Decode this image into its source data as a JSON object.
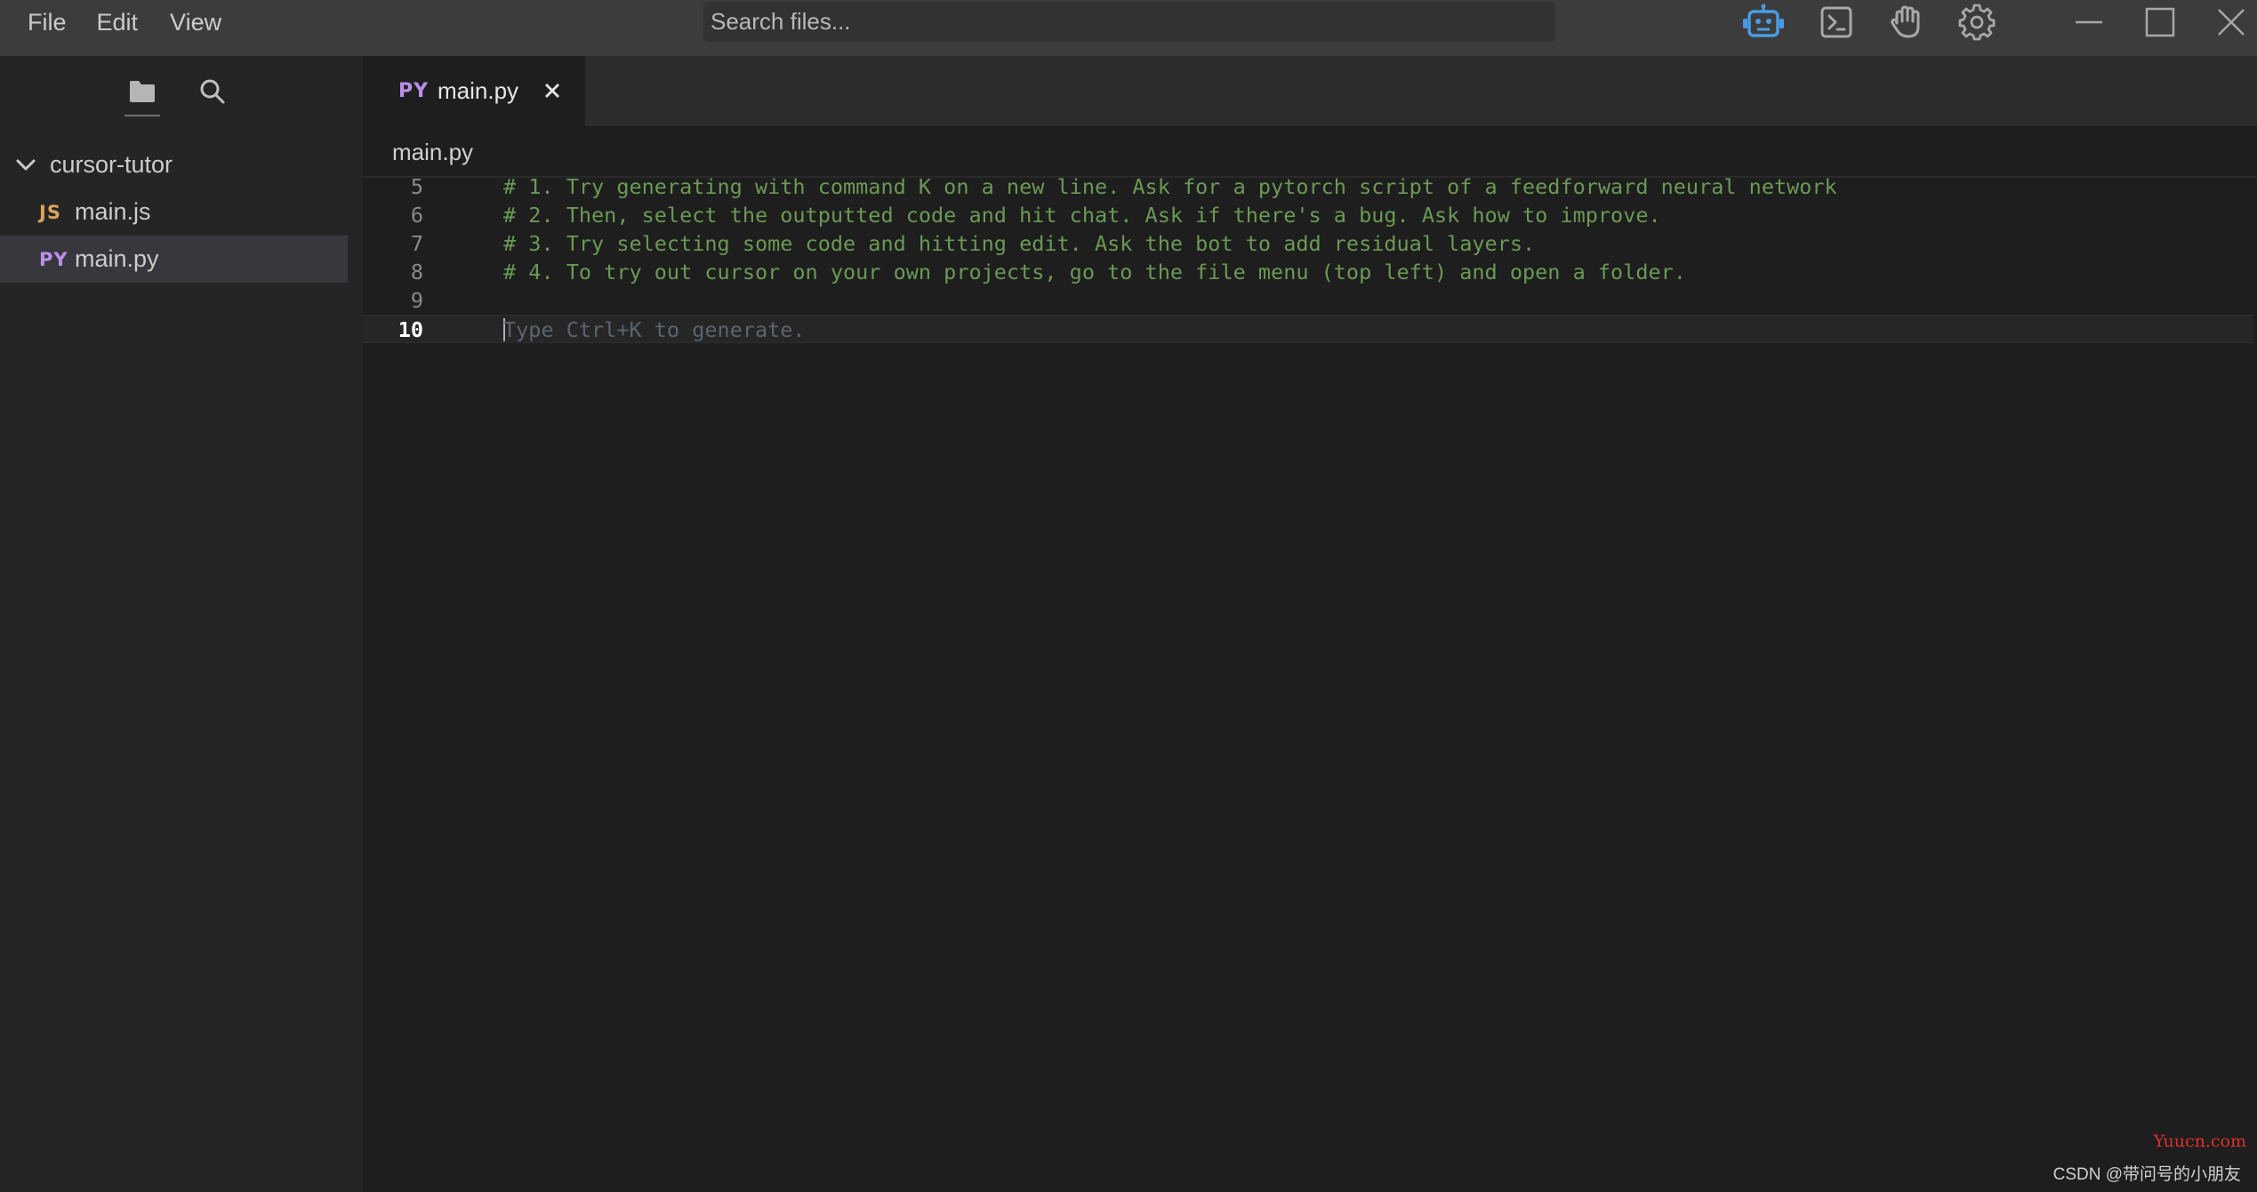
{
  "menu": {
    "items": [
      "File",
      "Edit",
      "View"
    ]
  },
  "search": {
    "placeholder": "Search files..."
  },
  "toolbar": {
    "icons": [
      "robot-icon",
      "terminal-icon",
      "hand-icon",
      "gear-icon"
    ],
    "accent_color": "#4a9be6"
  },
  "window_controls": [
    "minimize-icon",
    "maximize-icon",
    "close-icon"
  ],
  "sidebar": {
    "tabs": [
      "folder-icon",
      "search-icon"
    ],
    "folder": {
      "name": "cursor-tutor",
      "expanded": true
    },
    "files": [
      {
        "badge": "JS",
        "name": "main.js",
        "active": false
      },
      {
        "badge": "PY",
        "name": "main.py",
        "active": true
      }
    ]
  },
  "editor": {
    "tab": {
      "badge": "PY",
      "name": "main.py"
    },
    "breadcrumb": "main.py",
    "lines": [
      {
        "number": "5",
        "text": "# 1. Try generating with command K on a new line. Ask for a pytorch script of a feedforward neural network"
      },
      {
        "number": "6",
        "text": "# 2. Then, select the outputted code and hit chat. Ask if there's a bug. Ask how to improve."
      },
      {
        "number": "7",
        "text": "# 3. Try selecting some code and hitting edit. Ask the bot to add residual layers."
      },
      {
        "number": "8",
        "text": "# 4. To try out cursor on your own projects, go to the file menu (top left) and open a folder."
      },
      {
        "number": "9",
        "text": ""
      },
      {
        "number": "10",
        "text": "Type Ctrl+K to generate.",
        "placeholder": true,
        "current": true
      }
    ],
    "comment_color": "#6a9955"
  },
  "watermarks": [
    "Yuucn.com",
    "CSDN @带问号的小朋友"
  ]
}
